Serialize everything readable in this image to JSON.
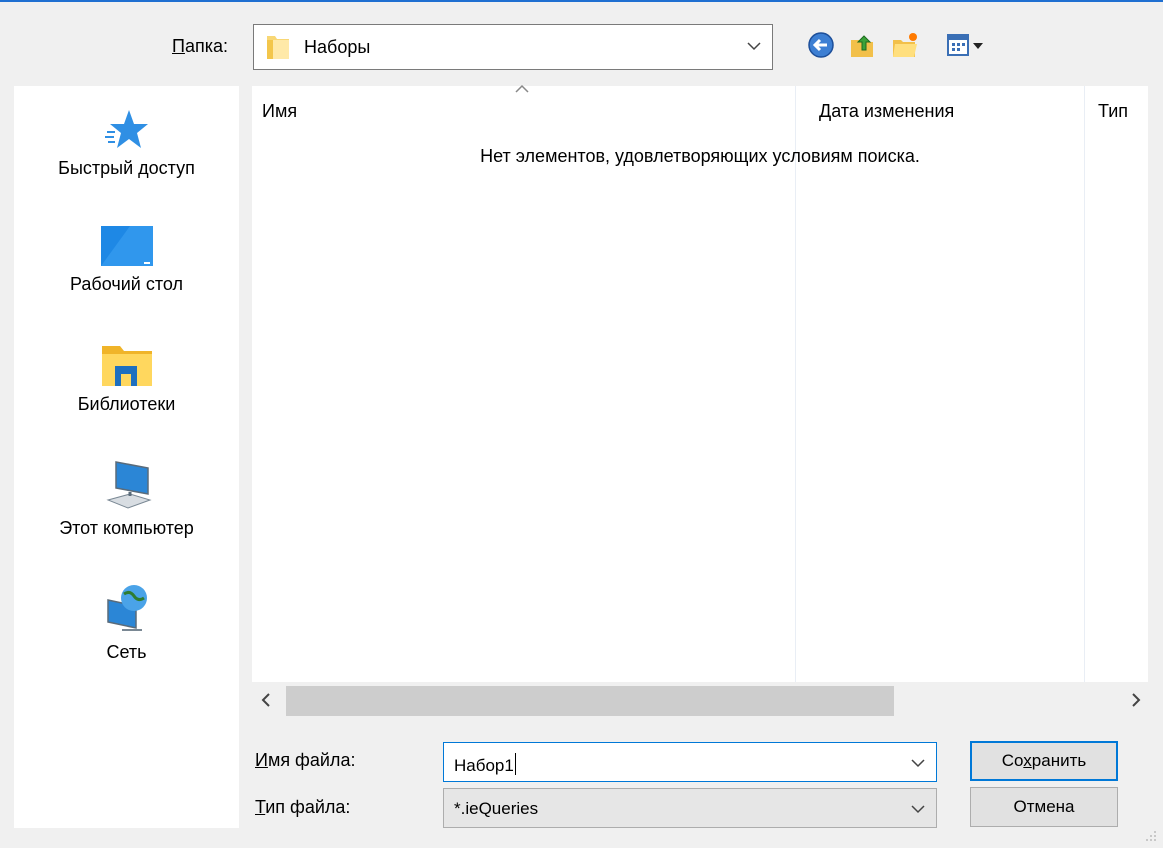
{
  "folder_label": "Папка:",
  "folder_label_hotkey": "П",
  "folder_label_rest": "апка:",
  "folder_value": "Наборы",
  "toolbar": {
    "back_icon": "back-arrow-icon",
    "up_icon": "up-folder-icon",
    "new_folder_icon": "new-folder-icon",
    "view_icon": "view-menu-icon"
  },
  "places": [
    {
      "label": "Быстрый доступ",
      "icon": "star-icon"
    },
    {
      "label": "Рабочий стол",
      "icon": "desktop-icon"
    },
    {
      "label": "Библиотеки",
      "icon": "library-icon"
    },
    {
      "label": "Этот компьютер",
      "icon": "computer-icon"
    },
    {
      "label": "Сеть",
      "icon": "network-icon"
    }
  ],
  "columns": [
    "Имя",
    "Дата изменения",
    "Тип"
  ],
  "empty_message": "Нет элементов, удовлетворяющих условиям поиска.",
  "filename_label_hotkey": "И",
  "filename_label_rest": "мя файла:",
  "filename_value": "Набор1",
  "filetype_label_hotkey": "Т",
  "filetype_label_rest": "ип файла:",
  "filetype_value": "*.ieQueries",
  "save_hotkey_pre": "Со",
  "save_hotkey": "х",
  "save_hotkey_post": "ранить",
  "cancel_label": "Отмена",
  "colors": {
    "accent": "#0078d7",
    "background": "#f0f0f0"
  }
}
